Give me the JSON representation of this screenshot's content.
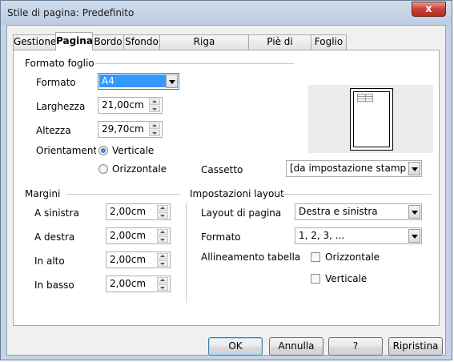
{
  "window": {
    "title": "Stile di pagina: Predefinito",
    "close_glyph": "x"
  },
  "tabs": [
    "Gestione",
    "Pagina",
    "Bordo",
    "Sfondo",
    "Riga d'intestazione",
    "Piè di pagina",
    "Foglio"
  ],
  "active_tab": "Pagina",
  "paper_format": {
    "section": "Formato foglio",
    "format_label": "Formato",
    "format_value": "A4",
    "width_label": "Larghezza",
    "width_value": "21,00cm",
    "height_label": "Altezza",
    "height_value": "29,70cm",
    "orientation_label": "Orientamento",
    "portrait_label": "Verticale",
    "landscape_label": "Orizzontale",
    "orientation_selected": "Verticale",
    "tray_label": "Cassetto",
    "tray_value": "[da impostazione stampante]"
  },
  "margins": {
    "section": "Margini",
    "left_label": "A sinistra",
    "left_value": "2,00cm",
    "right_label": "A destra",
    "right_value": "2,00cm",
    "top_label": "In alto",
    "top_value": "2,00cm",
    "bottom_label": "In basso",
    "bottom_value": "2,00cm"
  },
  "layout": {
    "section": "Impostazioni layout",
    "page_layout_label": "Layout di pagina",
    "page_layout_value": "Destra e sinistra",
    "format_label": "Formato",
    "format_value": "1, 2, 3, ...",
    "table_alignment_label": "Allineamento tabella",
    "horizontal_label": "Orizzontale",
    "vertical_label": "Verticale",
    "horizontal_checked": false,
    "vertical_checked": false
  },
  "buttons": {
    "ok": "OK",
    "cancel": "Annulla",
    "help": "?",
    "reset": "Ripristina"
  }
}
